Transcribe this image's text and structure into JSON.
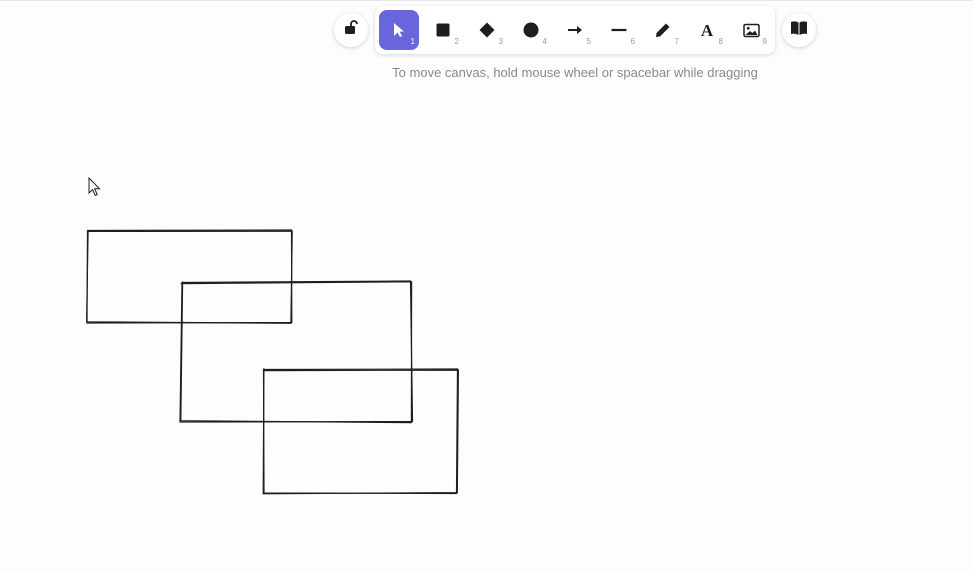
{
  "toolbar": {
    "lock": {
      "icon": "lock-open-icon"
    },
    "tools": [
      {
        "key": "1",
        "icon": "selection-arrow-icon",
        "active": true
      },
      {
        "key": "2",
        "icon": "rectangle-icon"
      },
      {
        "key": "3",
        "icon": "diamond-icon"
      },
      {
        "key": "4",
        "icon": "ellipse-icon"
      },
      {
        "key": "5",
        "icon": "arrow-icon"
      },
      {
        "key": "6",
        "icon": "line-icon"
      },
      {
        "key": "7",
        "icon": "pencil-icon"
      },
      {
        "key": "8",
        "icon": "text-icon"
      },
      {
        "key": "9",
        "icon": "image-icon"
      }
    ],
    "library": {
      "icon": "book-icon"
    },
    "accent_color": "#6965db"
  },
  "hint": "To move canvas, hold mouse wheel or spacebar while dragging",
  "canvas": {
    "shapes": [
      {
        "type": "rectangle",
        "stroke": "#1e1e1e"
      },
      {
        "type": "rectangle",
        "stroke": "#1e1e1e"
      },
      {
        "type": "rectangle",
        "stroke": "#1e1e1e"
      }
    ]
  }
}
